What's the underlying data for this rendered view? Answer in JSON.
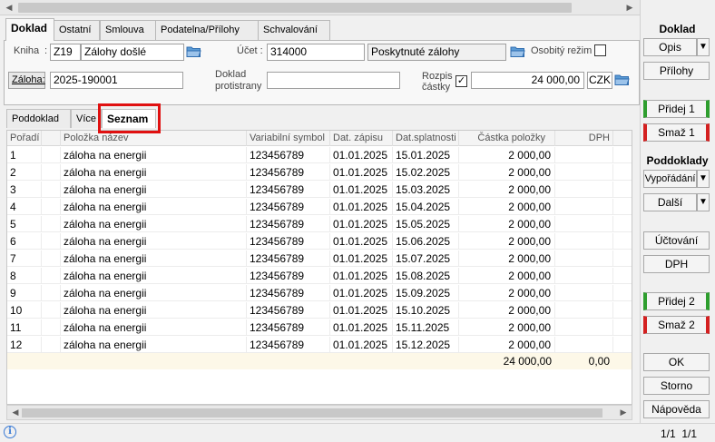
{
  "tabs": [
    "Doklad",
    "Ostatní",
    "Smlouva",
    "Podatelna/Přílohy",
    "Schvalování"
  ],
  "form": {
    "kniha_label": "Kniha",
    "kniha_code": "Z19",
    "kniha_name": "Zálohy došlé",
    "ucet_label": "Účet :",
    "ucet_code": "314000",
    "ucet_name": "Poskytnuté zálohy",
    "osobity_label": "Osobitý režim",
    "zaloha_label": "Záloha:",
    "zaloha_value": "2025-190001",
    "doklad_protistrany_label_1": "Doklad",
    "doklad_protistrany_label_2": "protistrany",
    "doklad_protistrany_value": "",
    "rozpis_label_1": "Rozpis",
    "rozpis_label_2": "částky",
    "rozpis_checked": "✓",
    "castka": "24 000,00",
    "mena": "CZK"
  },
  "subtabs": [
    "Poddoklad",
    "Více",
    "Seznam"
  ],
  "table": {
    "headers": [
      "Pořadí",
      "Položka název",
      "Variabilní symbol",
      "Dat. zápisu",
      "Dat.splatnosti",
      "Částka položky",
      "DPH"
    ],
    "rows": [
      [
        "1",
        "záloha na energii",
        "123456789",
        "01.01.2025",
        "15.01.2025",
        "2 000,00"
      ],
      [
        "2",
        "záloha na energii",
        "123456789",
        "01.01.2025",
        "15.02.2025",
        "2 000,00"
      ],
      [
        "3",
        "záloha na energii",
        "123456789",
        "01.01.2025",
        "15.03.2025",
        "2 000,00"
      ],
      [
        "4",
        "záloha na energii",
        "123456789",
        "01.01.2025",
        "15.04.2025",
        "2 000,00"
      ],
      [
        "5",
        "záloha na energii",
        "123456789",
        "01.01.2025",
        "15.05.2025",
        "2 000,00"
      ],
      [
        "6",
        "záloha na energii",
        "123456789",
        "01.01.2025",
        "15.06.2025",
        "2 000,00"
      ],
      [
        "7",
        "záloha na energii",
        "123456789",
        "01.01.2025",
        "15.07.2025",
        "2 000,00"
      ],
      [
        "8",
        "záloha na energii",
        "123456789",
        "01.01.2025",
        "15.08.2025",
        "2 000,00"
      ],
      [
        "9",
        "záloha na energii",
        "123456789",
        "01.01.2025",
        "15.09.2025",
        "2 000,00"
      ],
      [
        "10",
        "záloha na energii",
        "123456789",
        "01.01.2025",
        "15.10.2025",
        "2 000,00"
      ],
      [
        "11",
        "záloha na energii",
        "123456789",
        "01.01.2025",
        "15.11.2025",
        "2 000,00"
      ],
      [
        "12",
        "záloha na energii",
        "123456789",
        "01.01.2025",
        "15.12.2025",
        "2 000,00"
      ]
    ],
    "sum_castka": "24 000,00",
    "sum_dph": "0,00"
  },
  "right": {
    "doklad_title": "Doklad",
    "opis": "Opis",
    "prilohy": "Přílohy",
    "pridej1": "Přidej 1",
    "smaz1": "Smaž 1",
    "poddoklady_title": "Poddoklady",
    "vyporadani": "Vypořádání",
    "dalsi": "Další",
    "uctovani": "Účtování",
    "dph": "DPH",
    "pridej2": "Přidej 2",
    "smaz2": "Smaž 2",
    "ok": "OK",
    "storno": "Storno",
    "napoveda": "Nápověda"
  },
  "status": {
    "pager_1": "1/1",
    "pager_2": "1/1"
  }
}
